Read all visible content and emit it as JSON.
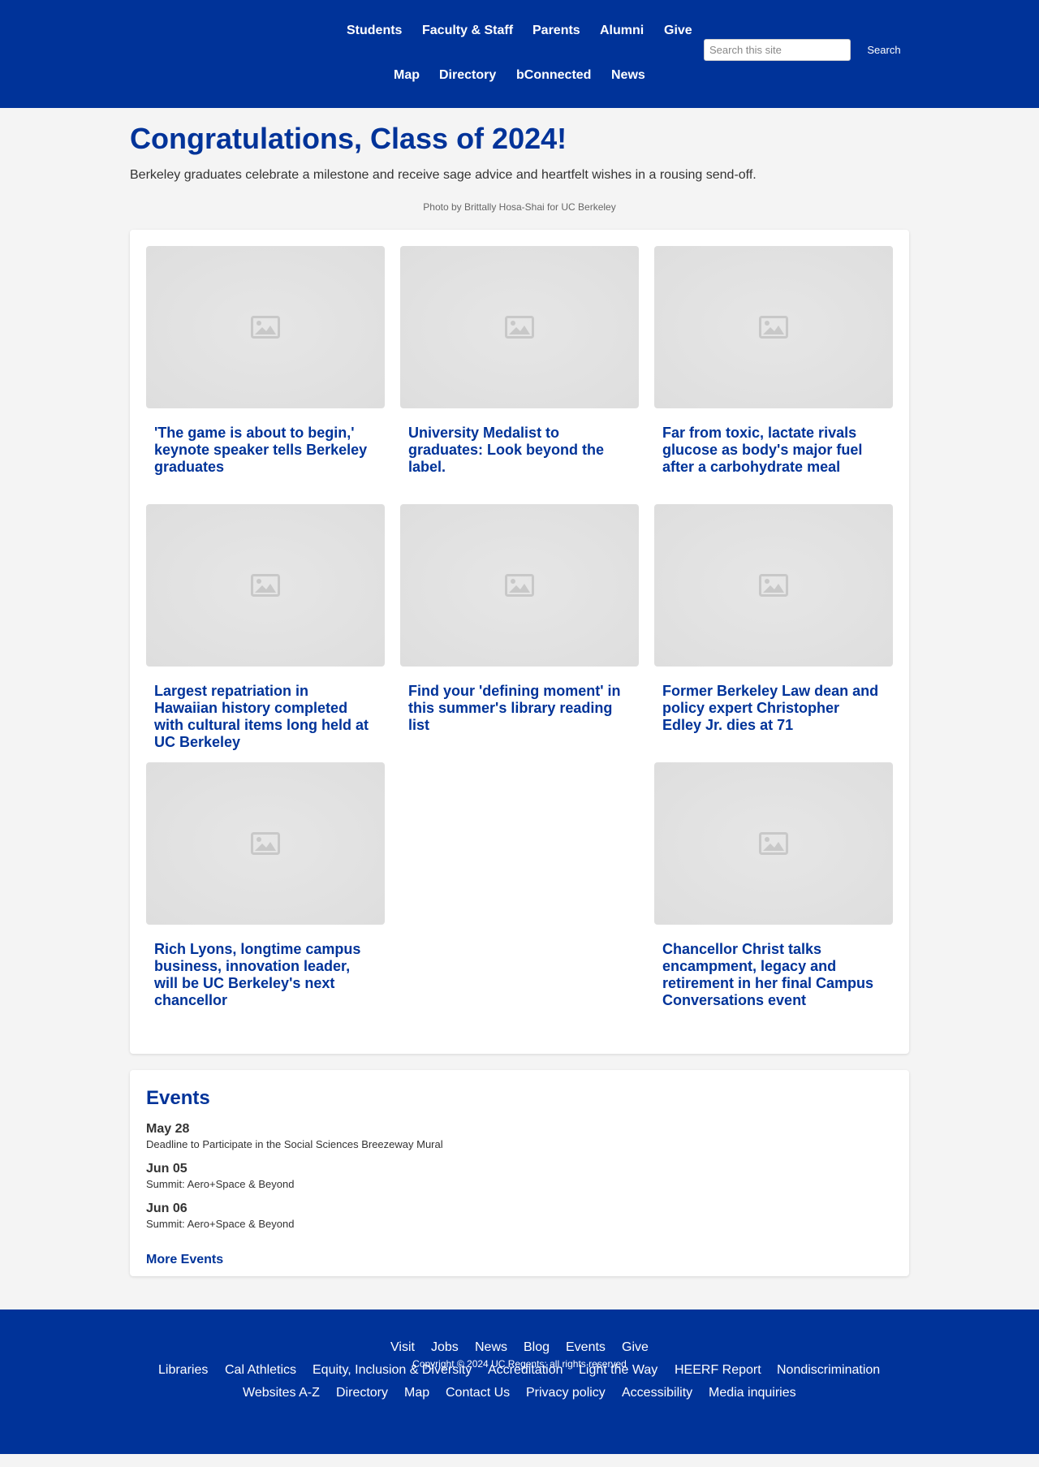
{
  "header": {
    "nav_primary": [
      "Students",
      "Faculty & Staff",
      "Parents",
      "Alumni",
      "Give"
    ],
    "nav_secondary": [
      "Map",
      "Directory",
      "bConnected",
      "News"
    ],
    "search": {
      "placeholder": "Search this site",
      "button_label": "Search"
    }
  },
  "hero": {
    "title": "Congratulations, Class of 2024!",
    "subtitle": "Berkeley graduates celebrate a milestone and receive sage advice and heartfelt wishes in a rousing send-off.",
    "photo_credit": "Photo by Brittally Hosa-Shai for UC Berkeley"
  },
  "news": [
    {
      "title": "'The game is about to begin,' keynote speaker tells Berkeley graduates",
      "image_icon": "image-placeholder-icon"
    },
    {
      "title": "University Medalist to graduates: Look beyond the label.",
      "image_icon": "image-placeholder-icon"
    },
    {
      "title": "Far from toxic, lactate rivals glucose as body's major fuel after a carbohydrate meal",
      "image_icon": "image-placeholder-icon"
    },
    {
      "title": "Largest repatriation in Hawaiian history completed with cultural items long held at UC Berkeley",
      "image_icon": "image-placeholder-icon"
    },
    {
      "title": "Find your 'defining moment' in this summer's library reading list",
      "image_icon": "image-placeholder-icon"
    },
    {
      "title": "Former Berkeley Law dean and policy expert Christopher Edley Jr. dies at 71",
      "image_icon": "image-placeholder-icon"
    },
    {
      "title": "Rich Lyons, longtime campus business, innovation leader, will be UC Berkeley's next chancellor",
      "image_icon": "image-placeholder-icon"
    },
    {
      "title": "Chancellor Christ talks encampment, legacy and retirement in her final Campus Conversations event",
      "image_icon": "image-placeholder-icon"
    }
  ],
  "events": {
    "heading": "Events",
    "items": [
      {
        "date": "May 28",
        "title": "Deadline to Participate in the Social Sciences Breezeway Mural"
      },
      {
        "date": "Jun 05",
        "title": "Summit: Aero+Space & Beyond"
      },
      {
        "date": "Jun 06",
        "title": "Summit: Aero+Space & Beyond"
      }
    ],
    "more_label": "More Events"
  },
  "footer": {
    "row1": [
      "Visit",
      "Jobs",
      "News",
      "Blog",
      "Events",
      "Give"
    ],
    "row2": [
      "Libraries",
      "Cal Athletics",
      "Equity, Inclusion & Diversity",
      "Accreditation",
      "Light the Way",
      "HEERF Report",
      "Nondiscrimination"
    ],
    "row3": [
      "Websites A-Z",
      "Directory",
      "Map",
      "Contact Us",
      "Privacy policy",
      "Accessibility",
      "Media inquiries"
    ],
    "copyright": "Copyright © 2024 UC Regents; all rights reserved"
  },
  "colors": {
    "brand_blue": "#003399",
    "page_background": "#f4f4f4",
    "panel_background": "#ffffff"
  }
}
